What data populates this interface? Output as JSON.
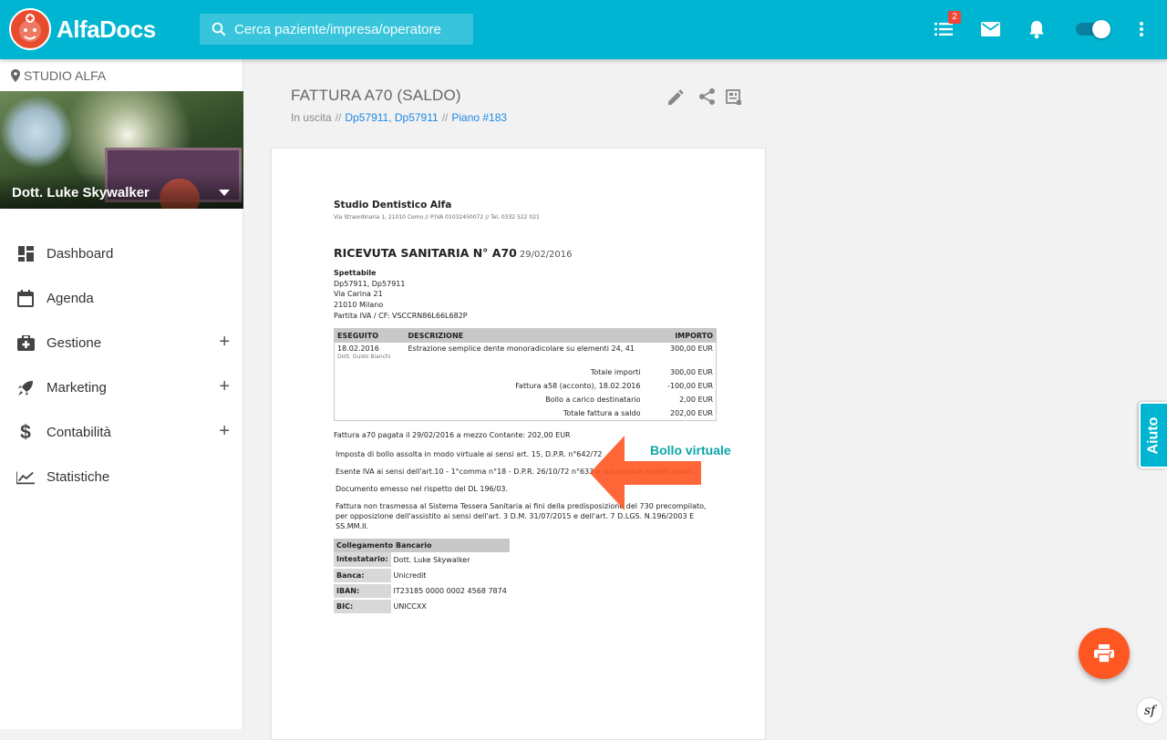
{
  "app": {
    "name": "AlfaDocs",
    "search_placeholder": "Cerca paziente/impresa/operatore",
    "tasks_badge": "2",
    "brand_color": "#00b5d1",
    "icons": [
      "tasks-icon",
      "mail-icon",
      "bell-icon",
      "toggle-switch",
      "more-vert-icon"
    ]
  },
  "sidebar": {
    "studio": "STUDIO ALFA",
    "user": "Dott. Luke Skywalker",
    "items": [
      {
        "label": "Dashboard",
        "icon": "dashboard-icon"
      },
      {
        "label": "Agenda",
        "icon": "calendar-icon"
      },
      {
        "label": "Gestione",
        "icon": "briefcase-medical-icon",
        "expand": "+"
      },
      {
        "label": "Marketing",
        "icon": "rocket-icon",
        "expand": "+"
      },
      {
        "label": "Contabilità",
        "icon": "dollar-icon",
        "expand": "+"
      },
      {
        "label": "Statistiche",
        "icon": "trending-up-icon"
      }
    ]
  },
  "document": {
    "title": "FATTURA A70 (SALDO)",
    "meta_status": "In uscita",
    "meta_sep": "//",
    "meta_patients": "Dp57911, Dp57911",
    "meta_plan": "Piano #183",
    "actions": [
      "edit-icon",
      "share-icon",
      "export-icon"
    ]
  },
  "invoice": {
    "company": "Studio Dentistico Alfa",
    "address": "Via Straordinaria 1, 21010 Como // P.IVA 01032450072 // Tel. 0332 522 021",
    "receipt_title": "RICEVUTA SANITARIA N° A70",
    "receipt_date": "29/02/2016",
    "recipient_label": "Spettabile",
    "recipient_lines": [
      "Dp57911, Dp57911",
      "Via Carina 21",
      "21010 Milano",
      "Partita IVA / CF: VSCCRN86L66L682P"
    ],
    "table_headers": {
      "date": "ESEGUITO",
      "desc": "DESCRIZIONE",
      "amount": "IMPORTO"
    },
    "row": {
      "date": "18.02.2016",
      "doctor": "Dott. Guido Bianchi",
      "desc": "Estrazione semplice dente monoradicolare su elementi 24, 41",
      "amount": "300,00 EUR"
    },
    "summary": [
      {
        "label": "Totale importi",
        "value": "300,00 EUR"
      },
      {
        "label": "Fattura a58 (acconto), 18.02.2016",
        "value": "-100,00 EUR"
      },
      {
        "label": "Bollo a carico destinatario",
        "value": "2,00 EUR"
      },
      {
        "label": "Totale fattura a saldo",
        "value": "202,00 EUR"
      }
    ],
    "paid": "Fattura a70 pagata il 29/02/2016 a mezzo Contante: 202,00 EUR",
    "notes": [
      "Imposta di bollo assolta in modo virtuale ai sensi art. 15, D.P.R. n°642/72",
      "Esente IVA ai sensi dell'art.10 - 1°comma n°18 - D.P.R. 26/10/72 n°633 e successive modificazioni.",
      "Documento emesso nel rispetto del DL 196/03.",
      "Fattura non trasmessa al Sistema Tessera Sanitaria ai fini della predisposizione del 730 precompilato, per opposizione dell'assistito ai sensi dell'art. 3 D.M. 31/07/2015 e dell'art. 7 D.LGS. N.196/2003 E SS.MM.II."
    ],
    "bank": {
      "title": "Collegamento Bancario",
      "rows": [
        {
          "k": "Intestatario:",
          "v": "Dott. Luke Skywalker"
        },
        {
          "k": "Banca:",
          "v": "Unicredit"
        },
        {
          "k": "IBAN:",
          "v": "IT23185 0000 0002 4568 7874"
        },
        {
          "k": "BIC:",
          "v": "UNICCXX"
        }
      ]
    }
  },
  "annotation": {
    "label": "Bollo virtuale",
    "color": "#0ea5a8",
    "arrow_color": "#ff5722"
  },
  "help_tab": "Aiuto",
  "fab": {
    "icon": "print-icon",
    "color": "#ff5722"
  },
  "debug_badge": "sf"
}
